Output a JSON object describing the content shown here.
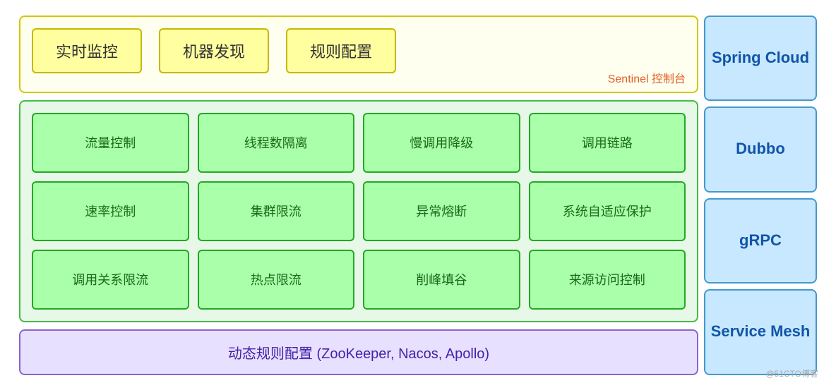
{
  "sentinel": {
    "label": "Sentinel 控制台",
    "boxes": [
      "实时监控",
      "机器发现",
      "规则配置"
    ]
  },
  "features": {
    "rows": [
      [
        "流量控制",
        "线程数隔离",
        "慢调用降级",
        "调用链路"
      ],
      [
        "速率控制",
        "集群限流",
        "异常熔断",
        "系统自适应保护"
      ],
      [
        "调用关系限流",
        "热点限流",
        "削峰填谷",
        "来源访问控制"
      ]
    ]
  },
  "dynamic": {
    "label": "动态规则配置 (ZooKeeper, Nacos, Apollo)"
  },
  "right_panel": {
    "items": [
      "Spring Cloud",
      "Dubbo",
      "gRPC",
      "Service Mesh"
    ]
  },
  "watermark": "@51CTO博客"
}
